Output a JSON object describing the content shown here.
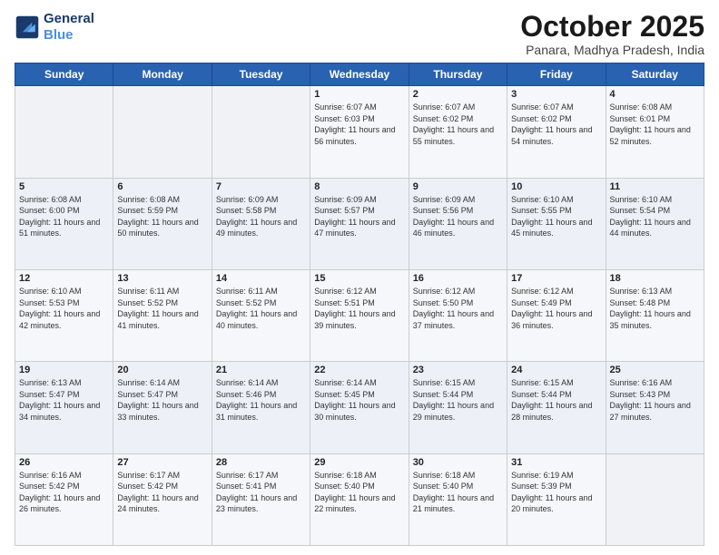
{
  "header": {
    "logo_line1": "General",
    "logo_line2": "Blue",
    "month": "October 2025",
    "location": "Panara, Madhya Pradesh, India"
  },
  "days_of_week": [
    "Sunday",
    "Monday",
    "Tuesday",
    "Wednesday",
    "Thursday",
    "Friday",
    "Saturday"
  ],
  "weeks": [
    [
      {
        "day": "",
        "sunrise": "",
        "sunset": "",
        "daylight": ""
      },
      {
        "day": "",
        "sunrise": "",
        "sunset": "",
        "daylight": ""
      },
      {
        "day": "",
        "sunrise": "",
        "sunset": "",
        "daylight": ""
      },
      {
        "day": "1",
        "sunrise": "6:07 AM",
        "sunset": "6:03 PM",
        "daylight": "11 hours and 56 minutes."
      },
      {
        "day": "2",
        "sunrise": "6:07 AM",
        "sunset": "6:02 PM",
        "daylight": "11 hours and 55 minutes."
      },
      {
        "day": "3",
        "sunrise": "6:07 AM",
        "sunset": "6:02 PM",
        "daylight": "11 hours and 54 minutes."
      },
      {
        "day": "4",
        "sunrise": "6:08 AM",
        "sunset": "6:01 PM",
        "daylight": "11 hours and 52 minutes."
      }
    ],
    [
      {
        "day": "5",
        "sunrise": "6:08 AM",
        "sunset": "6:00 PM",
        "daylight": "11 hours and 51 minutes."
      },
      {
        "day": "6",
        "sunrise": "6:08 AM",
        "sunset": "5:59 PM",
        "daylight": "11 hours and 50 minutes."
      },
      {
        "day": "7",
        "sunrise": "6:09 AM",
        "sunset": "5:58 PM",
        "daylight": "11 hours and 49 minutes."
      },
      {
        "day": "8",
        "sunrise": "6:09 AM",
        "sunset": "5:57 PM",
        "daylight": "11 hours and 47 minutes."
      },
      {
        "day": "9",
        "sunrise": "6:09 AM",
        "sunset": "5:56 PM",
        "daylight": "11 hours and 46 minutes."
      },
      {
        "day": "10",
        "sunrise": "6:10 AM",
        "sunset": "5:55 PM",
        "daylight": "11 hours and 45 minutes."
      },
      {
        "day": "11",
        "sunrise": "6:10 AM",
        "sunset": "5:54 PM",
        "daylight": "11 hours and 44 minutes."
      }
    ],
    [
      {
        "day": "12",
        "sunrise": "6:10 AM",
        "sunset": "5:53 PM",
        "daylight": "11 hours and 42 minutes."
      },
      {
        "day": "13",
        "sunrise": "6:11 AM",
        "sunset": "5:52 PM",
        "daylight": "11 hours and 41 minutes."
      },
      {
        "day": "14",
        "sunrise": "6:11 AM",
        "sunset": "5:52 PM",
        "daylight": "11 hours and 40 minutes."
      },
      {
        "day": "15",
        "sunrise": "6:12 AM",
        "sunset": "5:51 PM",
        "daylight": "11 hours and 39 minutes."
      },
      {
        "day": "16",
        "sunrise": "6:12 AM",
        "sunset": "5:50 PM",
        "daylight": "11 hours and 37 minutes."
      },
      {
        "day": "17",
        "sunrise": "6:12 AM",
        "sunset": "5:49 PM",
        "daylight": "11 hours and 36 minutes."
      },
      {
        "day": "18",
        "sunrise": "6:13 AM",
        "sunset": "5:48 PM",
        "daylight": "11 hours and 35 minutes."
      }
    ],
    [
      {
        "day": "19",
        "sunrise": "6:13 AM",
        "sunset": "5:47 PM",
        "daylight": "11 hours and 34 minutes."
      },
      {
        "day": "20",
        "sunrise": "6:14 AM",
        "sunset": "5:47 PM",
        "daylight": "11 hours and 33 minutes."
      },
      {
        "day": "21",
        "sunrise": "6:14 AM",
        "sunset": "5:46 PM",
        "daylight": "11 hours and 31 minutes."
      },
      {
        "day": "22",
        "sunrise": "6:14 AM",
        "sunset": "5:45 PM",
        "daylight": "11 hours and 30 minutes."
      },
      {
        "day": "23",
        "sunrise": "6:15 AM",
        "sunset": "5:44 PM",
        "daylight": "11 hours and 29 minutes."
      },
      {
        "day": "24",
        "sunrise": "6:15 AM",
        "sunset": "5:44 PM",
        "daylight": "11 hours and 28 minutes."
      },
      {
        "day": "25",
        "sunrise": "6:16 AM",
        "sunset": "5:43 PM",
        "daylight": "11 hours and 27 minutes."
      }
    ],
    [
      {
        "day": "26",
        "sunrise": "6:16 AM",
        "sunset": "5:42 PM",
        "daylight": "11 hours and 26 minutes."
      },
      {
        "day": "27",
        "sunrise": "6:17 AM",
        "sunset": "5:42 PM",
        "daylight": "11 hours and 24 minutes."
      },
      {
        "day": "28",
        "sunrise": "6:17 AM",
        "sunset": "5:41 PM",
        "daylight": "11 hours and 23 minutes."
      },
      {
        "day": "29",
        "sunrise": "6:18 AM",
        "sunset": "5:40 PM",
        "daylight": "11 hours and 22 minutes."
      },
      {
        "day": "30",
        "sunrise": "6:18 AM",
        "sunset": "5:40 PM",
        "daylight": "11 hours and 21 minutes."
      },
      {
        "day": "31",
        "sunrise": "6:19 AM",
        "sunset": "5:39 PM",
        "daylight": "11 hours and 20 minutes."
      },
      {
        "day": "",
        "sunrise": "",
        "sunset": "",
        "daylight": ""
      }
    ]
  ]
}
